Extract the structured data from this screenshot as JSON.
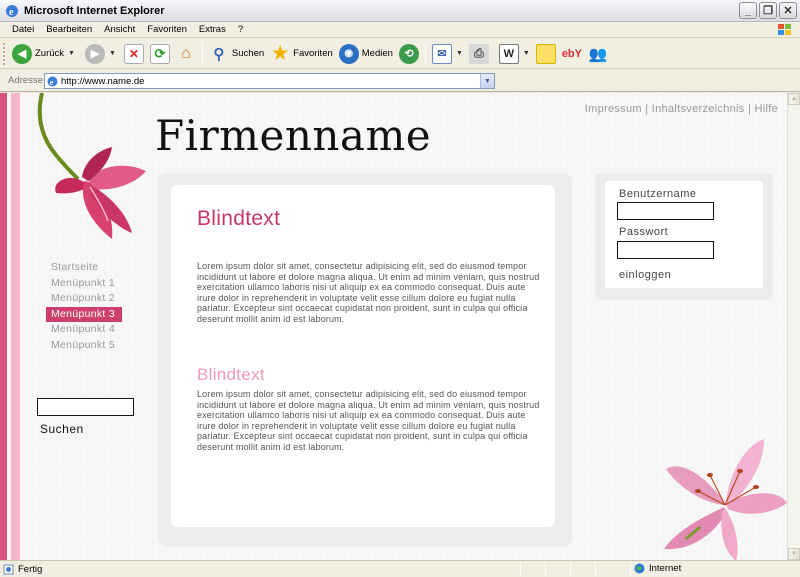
{
  "window": {
    "title": "Microsoft Internet Explorer"
  },
  "menu": [
    "Datei",
    "Bearbeiten",
    "Ansicht",
    "Favoriten",
    "Extras",
    "?"
  ],
  "toolbar": {
    "back_label": "Zurück",
    "search_label": "Suchen",
    "favorites_label": "Favoriten",
    "media_label": "Medien",
    "ebay_label": "ebY"
  },
  "address": {
    "label": "Adresse",
    "url": "http://www.name.de"
  },
  "page": {
    "company_name": "Firmenname",
    "top_links": [
      "Impressum",
      "Inhaltsverzeichnis",
      "Hilfe"
    ],
    "top_links_separator": " | ",
    "nav": [
      "Startseite",
      "Menüpunkt 1",
      "Menüpunkt 2",
      "Menüpunkt 3",
      "Menüpunkt 4",
      "Menüpunkt 5"
    ],
    "active_nav": "Menüpunkt 3",
    "search_label": "Suchen",
    "login": {
      "username_label": "Benutzername",
      "password_label": "Passwort",
      "login_label": "einloggen"
    },
    "heading1": "Blindtext",
    "paragraph1": "Lorem ipsum dolor sit amet, consectetur adipisicing elit, sed do eiusmod tempor incididunt ut labore et dolore magna aliqua. Ut enim ad minim veniam, quis nostrud exercitation ullamco laboris nisi ut aliquip ex ea commodo consequat. Duis aute irure dolor in reprehenderit in voluptate velit esse cillum dolore eu fugiat nulla pariatur. Excepteur sint occaecat cupidatat non proident, sunt in culpa qui officia deserunt mollit anim id est laborum.",
    "heading2": "Blindtext",
    "paragraph2": "Lorem ipsum dolor sit amet, consectetur adipisicing elit, sed do eiusmod tempor incididunt ut labore et dolore magna aliqua. Ut enim ad minim veniam, quis nostrud exercitation ullamco laboris nisi ut aliquip ex ea commodo consequat. Duis aute irure dolor in reprehenderit in voluptate velit esse cillum dolore eu fugiat nulla pariatur. Excepteur sint occaecat cupidatat non proident, sunt in culpa qui officia deserunt mollit anim id est laborum."
  },
  "status": {
    "text": "Fertig",
    "zone": "Internet"
  },
  "colors": {
    "accent": "#cf3f6c",
    "heading": "#c7356a",
    "heading_light": "#ee99b6",
    "stripe_light": "#f2b5c9"
  },
  "icons": [
    "ie-icon",
    "back-icon",
    "forward-icon",
    "stop-icon",
    "refresh-icon",
    "home-icon",
    "search-icon",
    "favorites-star-icon",
    "media-icon",
    "history-icon",
    "mail-icon",
    "print-icon",
    "edit-icon",
    "discuss-icon",
    "ebay-icon",
    "messenger-icon",
    "windows-logo-icon",
    "lily-flower-image"
  ]
}
